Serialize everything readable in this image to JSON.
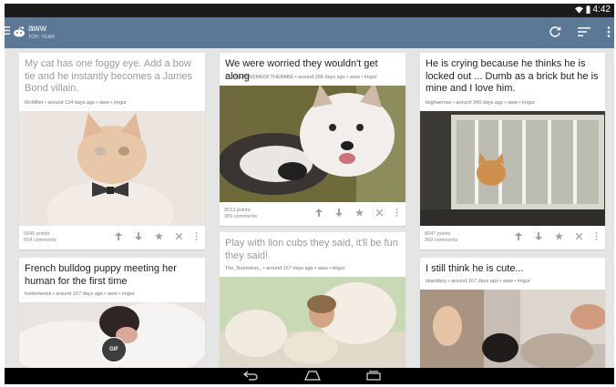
{
  "status_bar": {
    "time": "4:42"
  },
  "toolbar": {
    "title": "aww",
    "subtitle": "TOP: YEAR"
  },
  "colors": {
    "toolbar": "#5b7897",
    "background": "#e5e5e5"
  },
  "icons": {
    "refresh": "refresh-icon",
    "sort": "sort-icon",
    "overflow": "more-vert-icon"
  },
  "posts": [
    {
      "title": "My cat has one foggy eye. Add a bow tie and he instantly becomes a James Bond villain.",
      "meta": "McMiller • around 134 days ago • aww • imgur",
      "points": "9946 points",
      "comments": "654 comments"
    },
    {
      "title": "We were worried they wouldn't get along",
      "meta": "YOUREMINDMEOFTHEBABE • around 268 days ago • aww • imgur",
      "points": "9513 points",
      "comments": "389 comments"
    },
    {
      "title": "He is crying because he thinks he is locked out ... Dumb as a brick but he is mine and I love him.",
      "meta": "leighaerose • around 340 days ago • aww • imgur",
      "points": "8047 points",
      "comments": "368 comments"
    },
    {
      "title": "French bulldog puppy meeting her human for the first time",
      "meta": "holdenwook • around 167 days ago • aww • imgur",
      "badge": "GIF"
    },
    {
      "title": "Play with lion cubs they said, it'll be fun they said!",
      "meta": "The_Nameless_ • around 167 days ago • aww • imgur"
    },
    {
      "title": "I still think he is cute...",
      "meta": "skankboy • around 167 days ago • aww • imgur"
    }
  ]
}
